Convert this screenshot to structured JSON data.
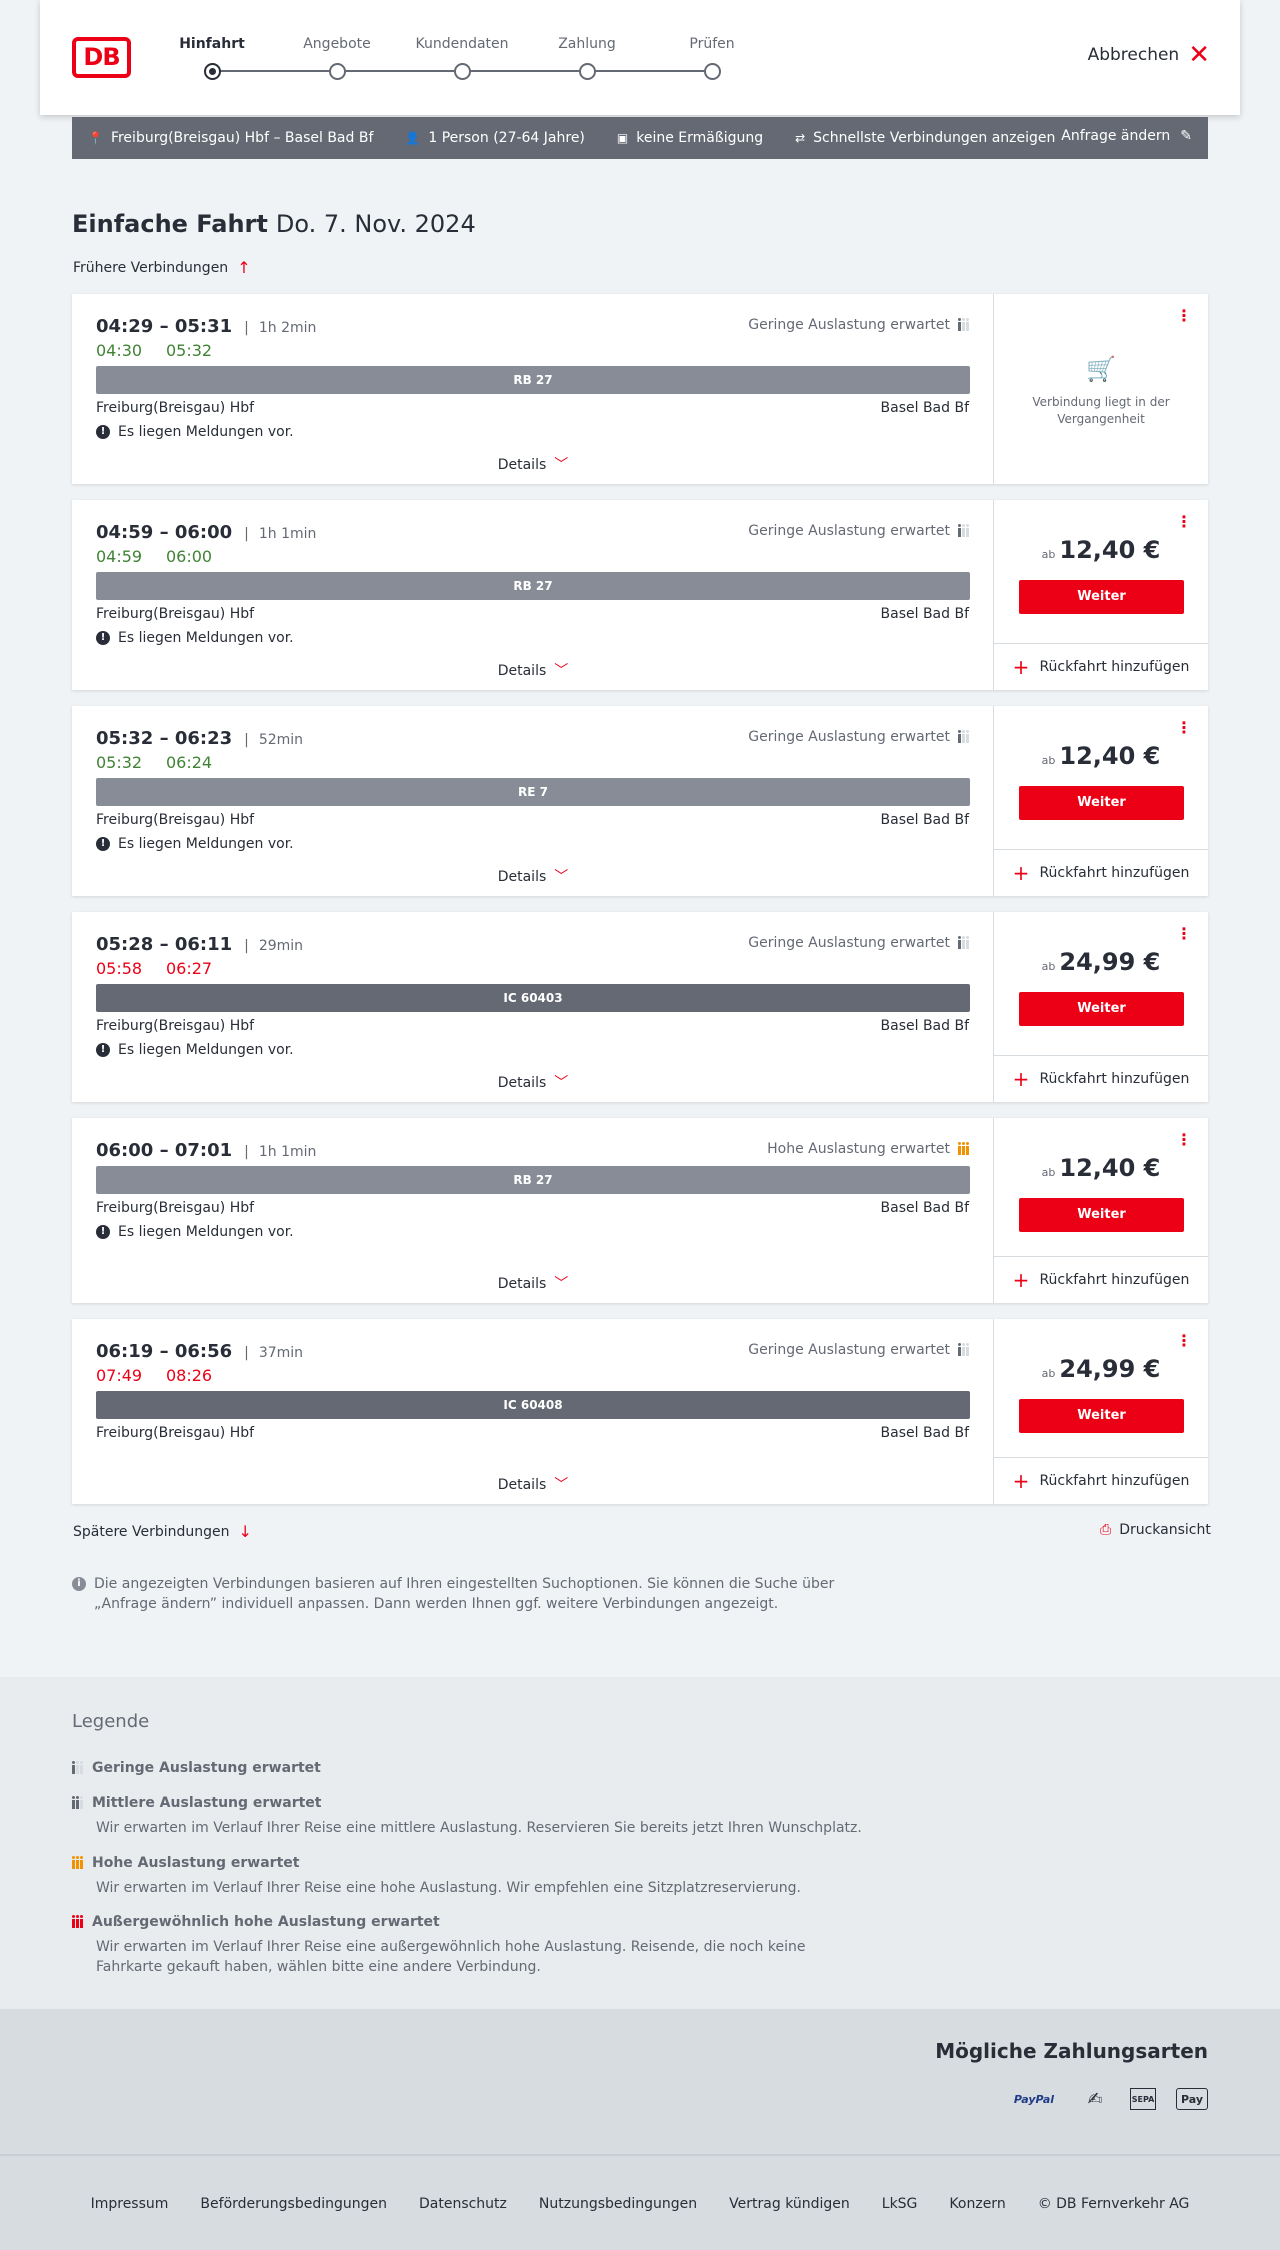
{
  "header": {
    "logo": "DB",
    "steps": [
      "Hinfahrt",
      "Angebote",
      "Kundendaten",
      "Zahlung",
      "Prüfen"
    ],
    "cancel_label": "Abbrechen"
  },
  "search": {
    "route": "Freiburg(Breisgau) Hbf – Basel Bad Bf",
    "travellers": "1 Person (27-64 Jahre)",
    "discount": "keine Ermäßigung",
    "fastest": "Schnellste Verbindungen anzeigen",
    "change": "Anfrage ändern"
  },
  "page": {
    "title": "Einfache Fahrt",
    "date": "Do. 7. Nov. 2024",
    "earlier": "Frühere Verbindungen",
    "later": "Spätere Verbindungen",
    "print": "Druckansicht"
  },
  "common": {
    "from": "Freiburg(Breisgau) Hbf",
    "to": "Basel Bad Bf",
    "message": "Es liegen Meldungen vor.",
    "details": "Details",
    "ab": "ab",
    "weiter": "Weiter",
    "return": "Rückfahrt hinzufügen",
    "past": "Verbindung liegt in der Vergangenheit"
  },
  "connections": [
    {
      "times": "04:29 – 05:31",
      "duration": "1h 2min",
      "rt_dep": "04:30",
      "rt_arr": "05:32",
      "rt_color": "green",
      "load": "Geringe Auslastung erwartet",
      "load_level": "low",
      "train": "RB 27",
      "message": true,
      "price": null,
      "past": true
    },
    {
      "times": "04:59 – 06:00",
      "duration": "1h 1min",
      "rt_dep": "04:59",
      "rt_arr": "06:00",
      "rt_color": "green",
      "load": "Geringe Auslastung erwartet",
      "load_level": "low",
      "train": "RB 27",
      "message": true,
      "price": "12,40 €"
    },
    {
      "times": "05:32 – 06:23",
      "duration": "52min",
      "rt_dep": "05:32",
      "rt_arr": "06:24",
      "rt_color": "green",
      "load": "Geringe Auslastung erwartet",
      "load_level": "low",
      "train": "RE 7",
      "message": true,
      "price": "12,40 €"
    },
    {
      "times": "05:28 – 06:11",
      "duration": "29min",
      "rt_dep": "05:58",
      "rt_arr": "06:27",
      "rt_color": "red",
      "load": "Geringe Auslastung erwartet",
      "load_level": "low",
      "train": "IC 60403",
      "message": true,
      "price": "24,99 €"
    },
    {
      "times": "06:00 – 07:01",
      "duration": "1h 1min",
      "rt_dep": "",
      "rt_arr": "",
      "rt_color": "green",
      "load": "Hohe Auslastung erwartet",
      "load_level": "high",
      "train": "RB 27",
      "message": true,
      "price": "12,40 €"
    },
    {
      "times": "06:19 – 06:56",
      "duration": "37min",
      "rt_dep": "07:49",
      "rt_arr": "08:26",
      "rt_color": "red",
      "load": "Geringe Auslastung erwartet",
      "load_level": "low",
      "train": "IC 60408",
      "message": false,
      "price": "24,99 €"
    }
  ],
  "info": "Die angezeigten Verbindungen basieren auf Ihren eingestellten Suchoptionen. Sie können die Suche über „Anfrage ändern” individuell anpassen. Dann werden Ihnen ggf. weitere Verbindungen angezeigt.",
  "legend": {
    "title": "Legende",
    "items": [
      {
        "title": "Geringe Auslastung erwartet",
        "desc": ""
      },
      {
        "title": "Mittlere Auslastung erwartet",
        "desc": "Wir erwarten im Verlauf Ihrer Reise eine mittlere Auslastung. Reservieren Sie bereits jetzt Ihren Wunschplatz."
      },
      {
        "title": "Hohe Auslastung erwartet",
        "desc": "Wir erwarten im Verlauf Ihrer Reise eine hohe Auslastung. Wir empfehlen eine Sitzplatzreservierung."
      },
      {
        "title": "Außergewöhnlich hohe Auslastung erwartet",
        "desc": "Wir erwarten im Verlauf Ihrer Reise eine außergewöhnlich hohe Auslastung. Reisende, die noch keine Fahrkarte gekauft haben, wählen bitte eine andere Verbindung."
      }
    ]
  },
  "payment": {
    "title": "Mögliche Zahlungsarten",
    "methods": [
      "PayPal",
      "Lastschrift",
      "SEPA",
      "Apple Pay"
    ]
  },
  "footer": {
    "links": [
      "Impressum",
      "Beförderungsbedingungen",
      "Datenschutz",
      "Nutzungsbedingungen",
      "Vertrag kündigen",
      "LkSG",
      "Konzern",
      "© DB Fernverkehr AG"
    ]
  },
  "colors": {
    "accent": "#ec0016",
    "delay_ok": "#408335",
    "bar": "#878c96"
  }
}
